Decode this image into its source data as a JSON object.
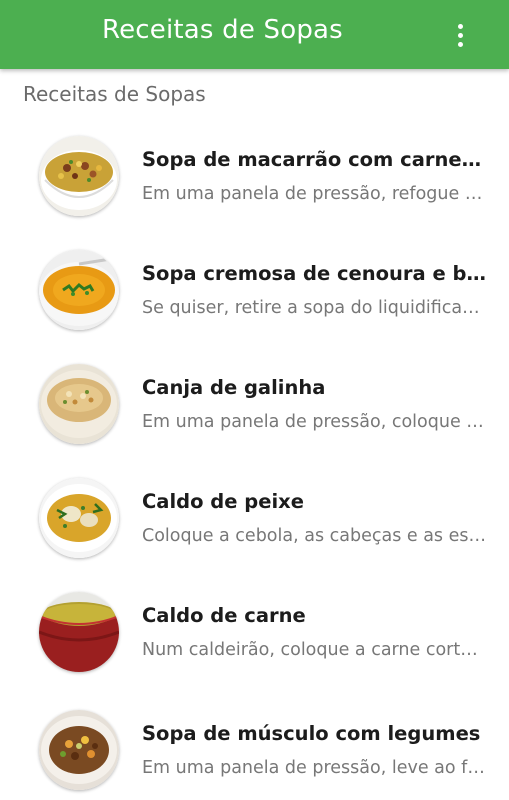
{
  "app_bar": {
    "title": "Receitas de Sopas",
    "overflow_icon": "more-vert-icon",
    "color": "#4caf50"
  },
  "section": {
    "header": "Receitas de Sopas"
  },
  "recipes": [
    {
      "title": "Sopa de macarrão com carne e l…",
      "subtitle": "Em uma panela de pressão, refogue …",
      "thumbnail": "macaroni-beef-soup-image"
    },
    {
      "title": "Sopa cremosa de cenoura e bat…",
      "subtitle": "Se quiser, retire a sopa do liquidificad…",
      "thumbnail": "carrot-cream-soup-image"
    },
    {
      "title": "Canja de galinha",
      "subtitle": "Em uma panela de pressão, coloque …",
      "thumbnail": "chicken-soup-image"
    },
    {
      "title": "Caldo de peixe",
      "subtitle": "Coloque a cebola, as cabeças e as es…",
      "thumbnail": "fish-broth-image"
    },
    {
      "title": "Caldo de carne",
      "subtitle": "Num caldeirão, coloque a carne corta…",
      "thumbnail": "beef-broth-image"
    },
    {
      "title": "Sopa de músculo com legumes",
      "subtitle": "Em uma panela de pressão, leve ao f…",
      "thumbnail": "beef-vegetable-soup-image"
    }
  ]
}
